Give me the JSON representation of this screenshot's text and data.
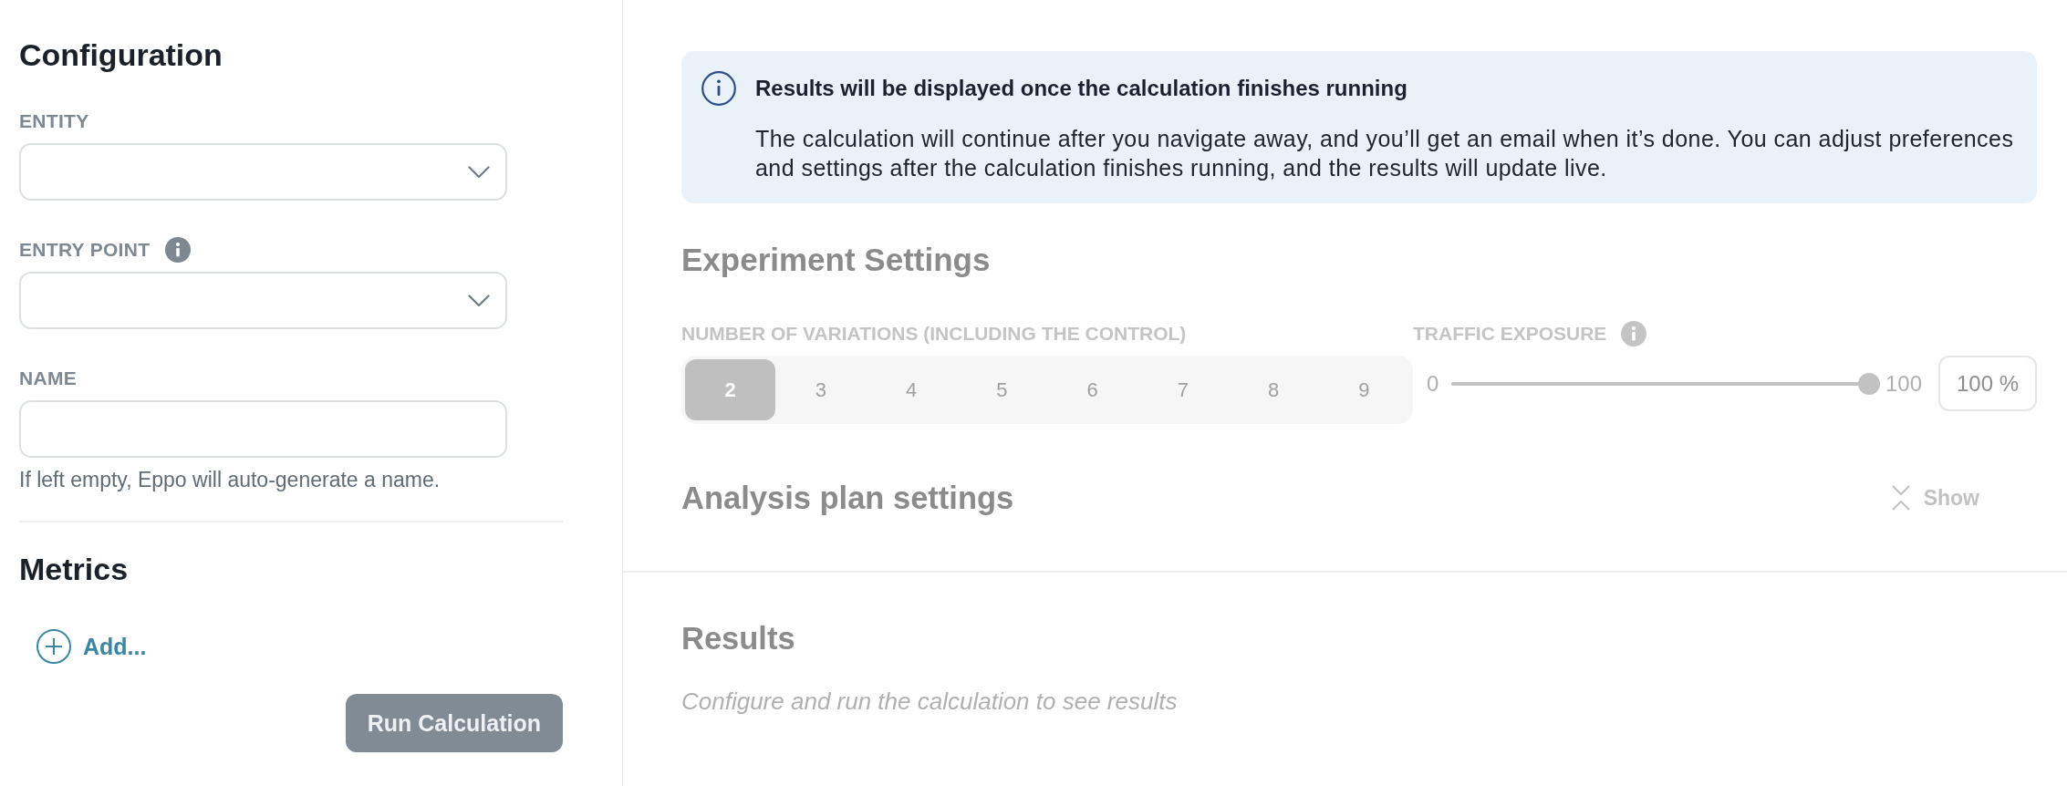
{
  "configuration": {
    "title": "Configuration",
    "fields": [
      {
        "kind": "select",
        "label": "ENTITY",
        "info": false
      },
      {
        "kind": "select",
        "label": "ENTRY POINT",
        "info": true
      },
      {
        "kind": "text",
        "label": "NAME",
        "info": false,
        "helper": "If left empty, Eppo will auto-generate a name."
      }
    ]
  },
  "metrics": {
    "title": "Metrics",
    "add": "Add..."
  },
  "run_button": {
    "label": "Run Calculation",
    "disabled": true
  },
  "banner": {
    "title": "Results will be displayed once the calculation finishes running",
    "body": "The calculation will continue after you navigate away, and you’ll get an email when it’s done. You can adjust preferences and settings after the calculation finishes running, and the results will update live."
  },
  "experiment_settings": {
    "title": "Experiment Settings",
    "disabled": true,
    "variations": {
      "label": "NUMBER OF VARIATIONS (INCLUDING THE CONTROL)",
      "options": [
        {
          "label": "2",
          "selected": true
        },
        {
          "label": "3",
          "selected": false
        },
        {
          "label": "4",
          "selected": false
        },
        {
          "label": "5",
          "selected": false
        },
        {
          "label": "6",
          "selected": false
        },
        {
          "label": "7",
          "selected": false
        },
        {
          "label": "8",
          "selected": false
        },
        {
          "label": "9",
          "selected": false
        }
      ]
    },
    "traffic_exposure": {
      "label": "TRAFFIC EXPOSURE",
      "info": true,
      "min": "0",
      "max": "100",
      "level": 1,
      "value": "100 %"
    }
  },
  "analysis_plan": {
    "title": "Analysis plan settings",
    "toggle": "Show",
    "expanded": false
  },
  "results": {
    "title": "Results",
    "message": "Configure and run the calculation to see results"
  }
}
